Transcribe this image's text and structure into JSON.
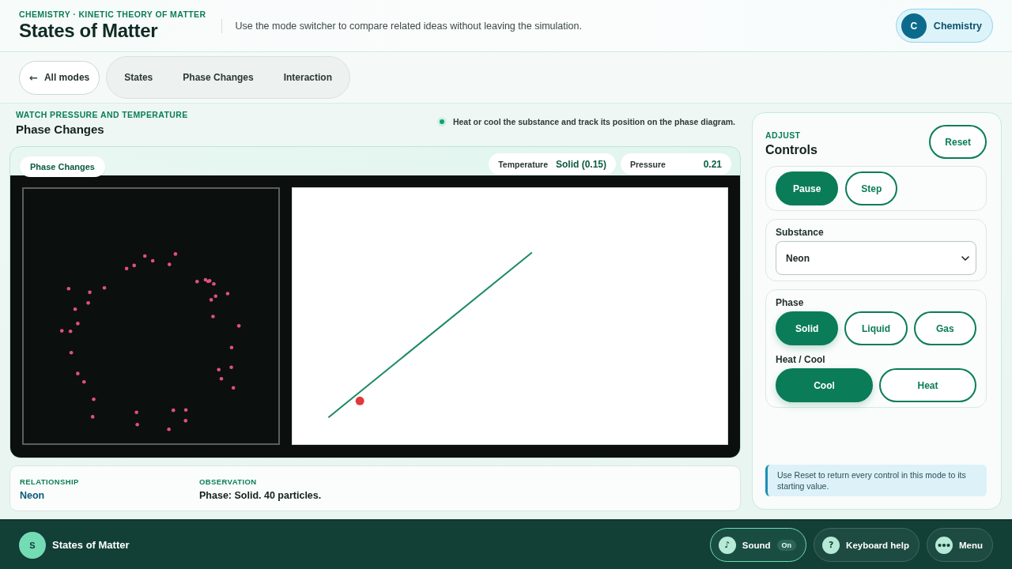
{
  "header": {
    "eyebrow": "CHEMISTRY · KINETIC THEORY OF MATTER",
    "title": "States of Matter",
    "tagline": "Use the mode switcher to compare related ideas without leaving the simulation.",
    "subject_badge": {
      "initial": "C",
      "label": "Chemistry"
    }
  },
  "nav": {
    "back": {
      "arrow": "←",
      "label": "All modes"
    },
    "tabs": [
      {
        "label": "States",
        "selected": false
      },
      {
        "label": "Phase Changes",
        "selected": false
      },
      {
        "label": "Interaction",
        "selected": false
      }
    ]
  },
  "stage": {
    "eyebrow": "WATCH PRESSURE AND TEMPERATURE",
    "title": "Phase Changes",
    "hint": "Heat or cool the substance and track its position on the phase diagram.",
    "mode_label": "Phase Changes",
    "readouts": [
      {
        "label": "Temperature",
        "value": "Solid (0.15)"
      },
      {
        "label": "Pressure",
        "value": "0.21"
      }
    ]
  },
  "info": [
    {
      "label": "RELATIONSHIP",
      "value": "Neon",
      "kind": "highlight"
    },
    {
      "label": "OBSERVATION",
      "value": "Phase: Solid. 40 particles.",
      "kind": "plain"
    }
  ],
  "controls": {
    "eyebrow": "ADJUST",
    "title": "Controls",
    "reset": "Reset",
    "playback": [
      {
        "label": "Pause",
        "kind": "primary"
      },
      {
        "label": "Step",
        "kind": "outline"
      }
    ],
    "substance": {
      "label": "Substance",
      "value": "Neon"
    },
    "phase": {
      "label": "Phase",
      "options": [
        {
          "label": "Solid",
          "selected": true
        },
        {
          "label": "Liquid",
          "selected": false
        },
        {
          "label": "Gas",
          "selected": false
        }
      ]
    },
    "heat_cool": {
      "label": "Heat / Cool",
      "options": [
        {
          "label": "Cool",
          "selected": true
        },
        {
          "label": "Heat",
          "selected": false
        }
      ]
    },
    "note": "Use Reset to return every control in this mode to its starting value."
  },
  "footer": {
    "logo_initial": "S",
    "title": "States of Matter",
    "buttons": [
      {
        "kind": "sound",
        "glyph": "♪",
        "label": "Sound",
        "badge": "On",
        "on": true
      },
      {
        "kind": "help",
        "glyph": "?",
        "label": "Keyboard help"
      },
      {
        "kind": "menu",
        "label": "Menu"
      }
    ]
  }
}
